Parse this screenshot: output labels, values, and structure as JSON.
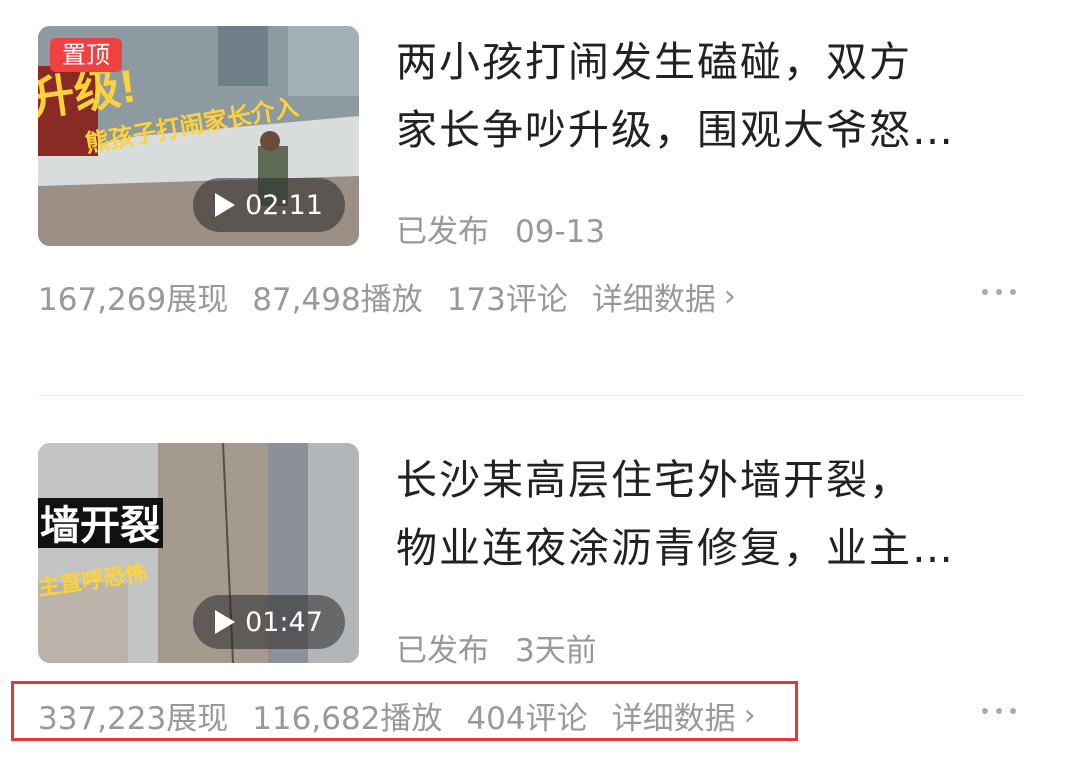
{
  "videos": [
    {
      "pin_label": "置顶",
      "thumb_text_1": "升级!",
      "thumb_text_2": "熊孩子打闹家长介入",
      "duration": "02:11",
      "title_line_1": "两小孩打闹发生磕碰，双方",
      "title_line_2": "家长争吵升级，围观大爷怒…",
      "status": "已发布",
      "date": "09-13",
      "impressions": "167,269展现",
      "plays": "87,498播放",
      "comments": "173评论",
      "detail_label": "详细数据"
    },
    {
      "thumb_text_1": "墙开裂",
      "thumb_text_2": "主直呼恐怖",
      "duration": "01:47",
      "title_line_1": "长沙某高层住宅外墙开裂，",
      "title_line_2": "物业连夜涂沥青修复，业主…",
      "status": "已发布",
      "date": "3天前",
      "impressions": "337,223展现",
      "plays": "116,682播放",
      "comments": "404评论",
      "detail_label": "详细数据"
    }
  ],
  "colors": {
    "highlight": "#e53935",
    "pin": "#f04142",
    "accent_text": "#222222",
    "muted": "#999999"
  },
  "icons": [
    "play-icon",
    "chevron-right-icon",
    "more-icon"
  ]
}
